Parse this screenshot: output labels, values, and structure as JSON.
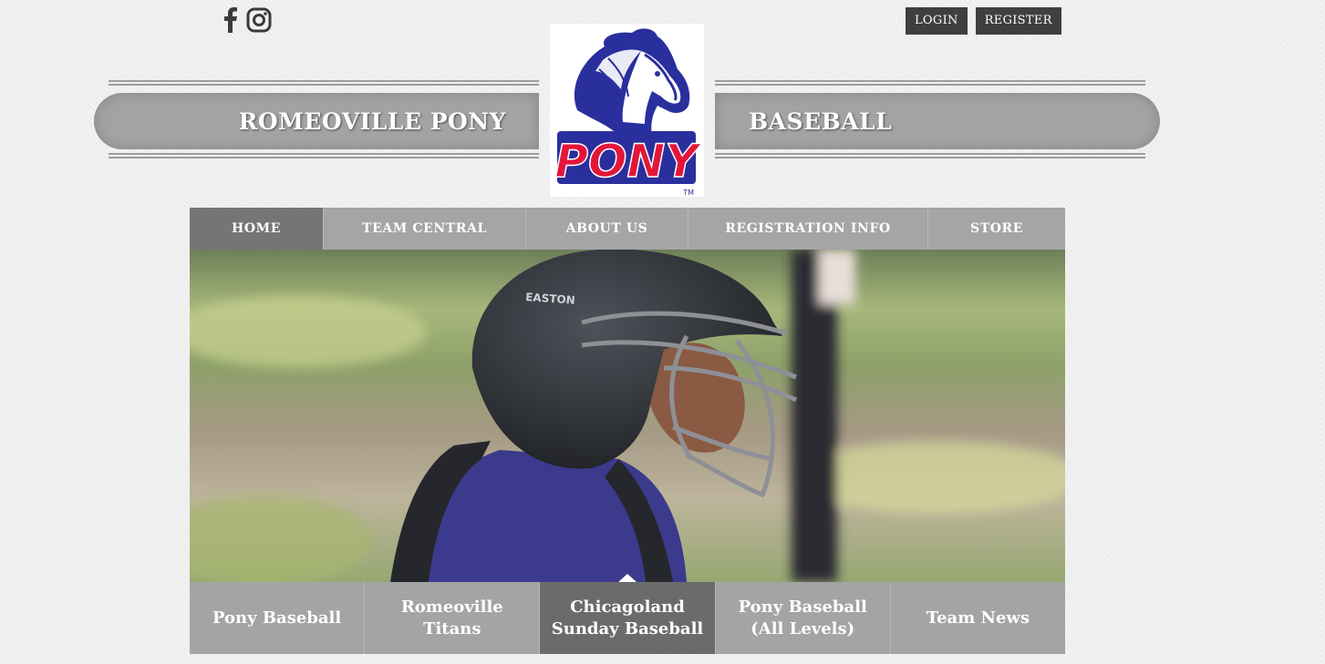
{
  "social": {
    "icons": [
      "facebook-icon",
      "instagram-icon"
    ]
  },
  "auth": {
    "login_label": "LOGIN",
    "register_label": "REGISTER"
  },
  "header": {
    "title_left": "ROMEOVILLE PONY",
    "title_right": "BASEBALL",
    "logo_text": "PONY",
    "logo_tm": "TM"
  },
  "nav": {
    "items": [
      {
        "label": "HOME",
        "active": true
      },
      {
        "label": "TEAM CENTRAL",
        "active": false
      },
      {
        "label": "ABOUT US",
        "active": false
      },
      {
        "label": "REGISTRATION INFO",
        "active": false
      },
      {
        "label": "STORE",
        "active": false
      }
    ]
  },
  "hero": {
    "helmet_brand": "EASTON"
  },
  "slides": {
    "items": [
      {
        "label": "Pony Baseball"
      },
      {
        "label": "Romeoville\nTitans"
      },
      {
        "label": "Chicagoland\nSunday Baseball"
      },
      {
        "label": "Pony Baseball\n(All Levels)"
      },
      {
        "label": "Team News"
      }
    ],
    "active_index": 2
  },
  "colors": {
    "nav_bg": "#a5a5a5",
    "nav_active": "#757575",
    "auth_bg": "#3f3f3f",
    "slide_active": "#6b6b6b",
    "logo_red": "#e3163a",
    "logo_blue": "#2a2f9e"
  }
}
